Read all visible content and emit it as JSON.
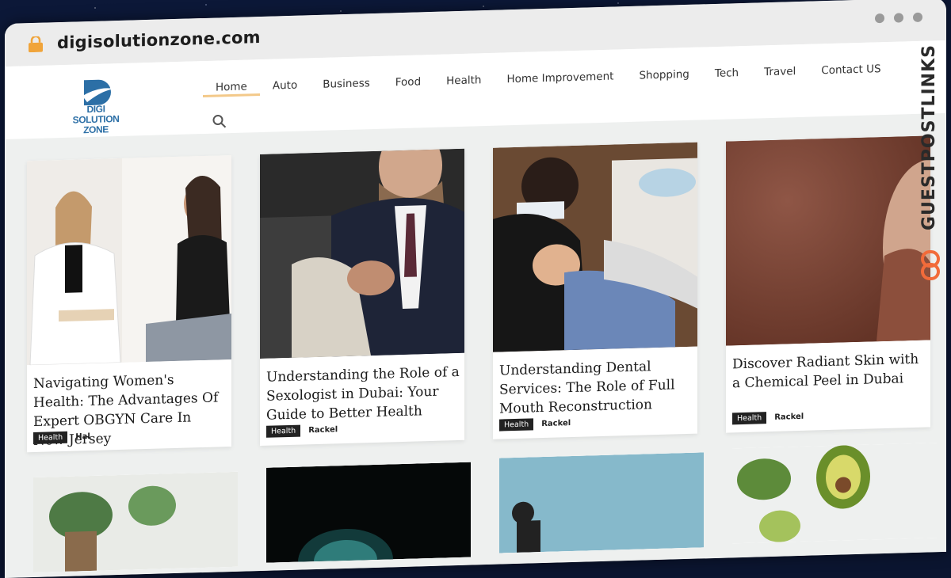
{
  "browser": {
    "url": "digisolutionzone.com"
  },
  "site": {
    "logo_line1": "DIGI SOLUTION",
    "logo_line2": "ZONE",
    "nav": [
      "Home",
      "Auto",
      "Business",
      "Food",
      "Health",
      "Home Improvement",
      "Shopping",
      "Tech",
      "Travel",
      "Contact US"
    ],
    "active_nav": "Home"
  },
  "posts": [
    {
      "title": "Navigating Women's Health: The Advantages Of Expert OBGYN Care In New Jersey",
      "category": "Health",
      "author": "Hal"
    },
    {
      "title": "Understanding the Role of a Sexologist in Dubai: Your Guide to Better Health",
      "category": "Health",
      "author": "Rackel"
    },
    {
      "title": "Understanding Dental Services: The Role of Full Mouth Reconstruction",
      "category": "Health",
      "author": "Rackel"
    },
    {
      "title": "Discover Radiant Skin with a Chemical Peel in Dubai",
      "category": "Health",
      "author": "Rackel"
    }
  ],
  "watermark": "GUESTPOSTLINKS",
  "colors": {
    "accent_underline": "#f3c98a",
    "logo_blue": "#2c6fa6",
    "badge_bg": "#222222"
  }
}
